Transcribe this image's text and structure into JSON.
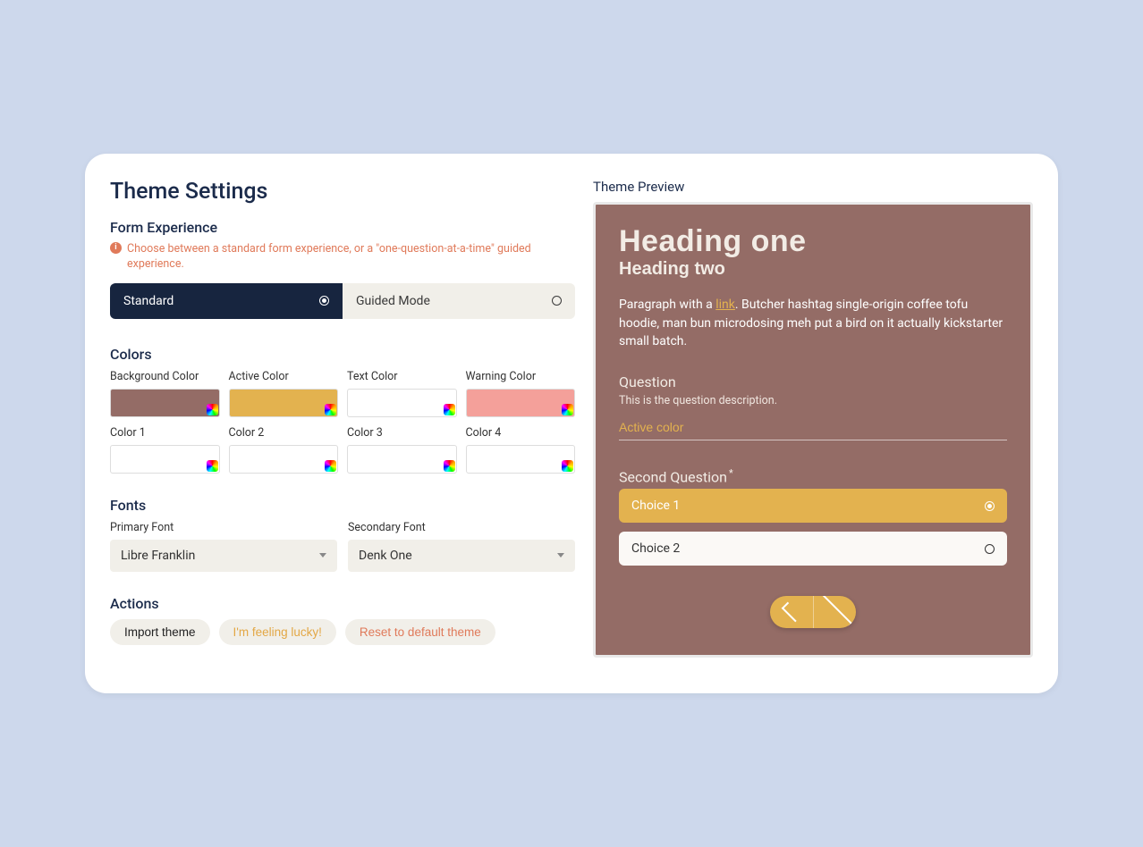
{
  "settings": {
    "title": "Theme Settings",
    "experience": {
      "title": "Form Experience",
      "desc": "Choose between a standard form experience, or a \"one-question-at-a-time\" guided experience.",
      "options": [
        {
          "label": "Standard",
          "selected": true
        },
        {
          "label": "Guided Mode",
          "selected": false
        }
      ]
    },
    "colors_title": "Colors",
    "colors": [
      {
        "label": "Background Color",
        "value": "#946c66"
      },
      {
        "label": "Active Color",
        "value": "#e3b24f"
      },
      {
        "label": "Text Color",
        "value": "#ffffff"
      },
      {
        "label": "Warning Color",
        "value": "#f4a09a"
      },
      {
        "label": "Color 1",
        "value": "#ffffff"
      },
      {
        "label": "Color 2",
        "value": "#ffffff"
      },
      {
        "label": "Color 3",
        "value": "#ffffff"
      },
      {
        "label": "Color 4",
        "value": "#ffffff"
      }
    ],
    "fonts_title": "Fonts",
    "fonts": {
      "primary": {
        "label": "Primary Font",
        "value": "Libre Franklin"
      },
      "secondary": {
        "label": "Secondary Font",
        "value": "Denk One"
      }
    },
    "actions_title": "Actions",
    "actions": {
      "import": "Import theme",
      "lucky": "I'm feeling lucky!",
      "reset": "Reset to default theme"
    }
  },
  "preview": {
    "title": "Theme Preview",
    "h1": "Heading one",
    "h2": "Heading two",
    "para_pre": "Paragraph with a ",
    "link": "link",
    "para_post": ". Butcher hashtag single-origin coffee tofu hoodie, man bun microdosing meh put a bird on it actually kickstarter small batch.",
    "q1": {
      "label": "Question",
      "desc": "This is the question description.",
      "placeholder": "Active color"
    },
    "q2": {
      "label": "Second Question",
      "required_mark": "*",
      "choices": [
        {
          "label": "Choice 1",
          "selected": true
        },
        {
          "label": "Choice 2",
          "selected": false
        }
      ]
    }
  }
}
